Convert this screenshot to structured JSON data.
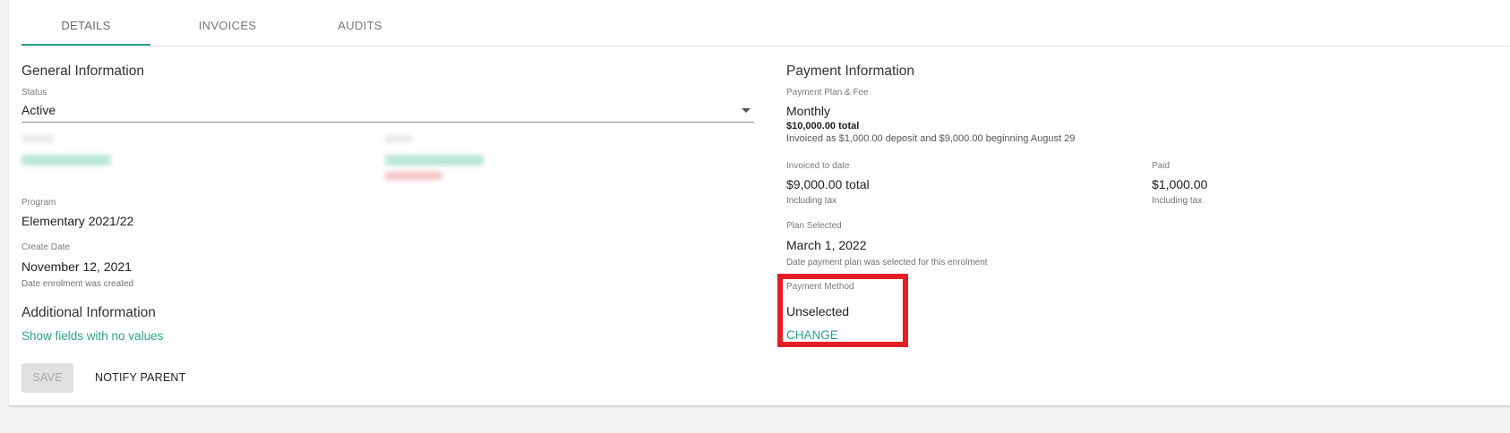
{
  "tabs": [
    {
      "label": "DETAILS",
      "active": true
    },
    {
      "label": "INVOICES",
      "active": false
    },
    {
      "label": "AUDITS",
      "active": false
    }
  ],
  "general": {
    "title": "General Information",
    "status_label": "Status",
    "status_value": "Active",
    "program_label": "Program",
    "program_value": "Elementary 2021/22",
    "create_date_label": "Create Date",
    "create_date_value": "November 12, 2021",
    "create_date_hint": "Date enrolment was created"
  },
  "additional": {
    "title": "Additional Information",
    "show_fields_link": "Show fields with no values"
  },
  "actions": {
    "save_label": "SAVE",
    "notify_label": "NOTIFY PARENT"
  },
  "payment": {
    "title": "Payment Information",
    "plan_fee_label": "Payment Plan & Fee",
    "plan_value": "Monthly",
    "plan_total": "$10,000.00 total",
    "plan_invoiced_note": "Invoiced as $1,000.00 deposit and $9,000.00 beginning August 29",
    "invoiced_label": "Invoiced to date",
    "invoiced_value": "$9,000.00 total",
    "invoiced_hint": "Including tax",
    "paid_label": "Paid",
    "paid_value": "$1,000.00",
    "paid_hint": "Including tax",
    "plan_selected_label": "Plan Selected",
    "plan_selected_value": "March 1, 2022",
    "plan_selected_hint": "Date payment plan was selected for this enrolment",
    "method_label": "Payment Method",
    "method_value": "Unselected",
    "change_link": "CHANGE"
  },
  "colors": {
    "accent": "#2ba384",
    "highlight": "#e41e26"
  }
}
